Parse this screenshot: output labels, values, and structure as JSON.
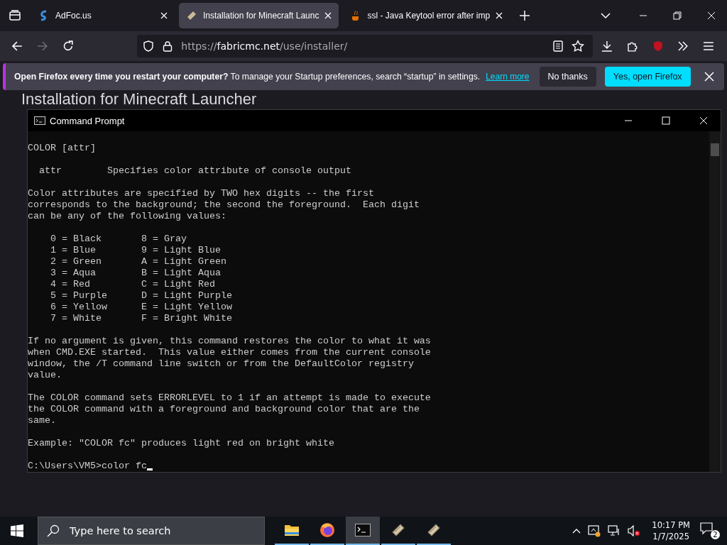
{
  "browser": {
    "tabs": [
      {
        "title": "AdFoc.us",
        "selected": false
      },
      {
        "title": "Installation for Minecraft Launc",
        "selected": true
      },
      {
        "title": "ssl - Java Keytool error after imp",
        "selected": false
      }
    ],
    "nav": {
      "forward_disabled": true,
      "url_prefix": "https://",
      "url_domain": "fabricmc.net",
      "url_path": "/use/installer/"
    },
    "notification": {
      "message": "**Open Firefox every time you restart your computer?** To manage your Startup preferences, search “startup” in settings.",
      "link": "Learn more",
      "buttons": [
        {
          "label": "No thanks",
          "kind": "secondary"
        },
        {
          "label": "Yes, open Firefox",
          "kind": "primary"
        }
      ]
    }
  },
  "page": {
    "heading": "Installation for Minecraft Launcher"
  },
  "console": {
    "title": "Command Prompt",
    "blocks": [
      [
        "COLOR [attr]"
      ],
      [
        "  attr        Specifies color attribute of console output"
      ],
      [
        "Color attributes are specified by TWO hex digits -- the first",
        "corresponds to the background; the second the foreground.  Each digit",
        "can be any of the following values:"
      ],
      [
        "    0 = Black       8 = Gray",
        "    1 = Blue        9 = Light Blue",
        "    2 = Green       A = Light Green",
        "    3 = Aqua        B = Light Aqua",
        "    4 = Red         C = Light Red",
        "    5 = Purple      D = Light Purple",
        "    6 = Yellow      E = Light Yellow",
        "    7 = White       F = Bright White"
      ],
      [
        "If no argument is given, this command restores the color to what it was",
        "when CMD.EXE started.  This value either comes from the current console",
        "window, the /T command line switch or from the DefaultColor registry",
        "value."
      ],
      [
        "The COLOR command sets ERRORLEVEL to 1 if an attempt is made to execute",
        "the COLOR command with a foreground and background color that are the",
        "same."
      ],
      [
        "Example: \"COLOR fc\" produces light red on bright white"
      ]
    ],
    "prompt": "C:\\Users\\VM5>color fc"
  },
  "taskbar": {
    "search_placeholder": "Type here to search",
    "apps": [
      {
        "kind": "folder",
        "selected": false
      },
      {
        "kind": "firefox",
        "selected": false
      },
      {
        "kind": "terminal",
        "selected": true
      },
      {
        "kind": "fabric",
        "selected": false
      },
      {
        "kind": "fabric",
        "selected": false
      }
    ],
    "time": "10:17 PM",
    "date": "1/7/2025",
    "notifications": "2"
  }
}
